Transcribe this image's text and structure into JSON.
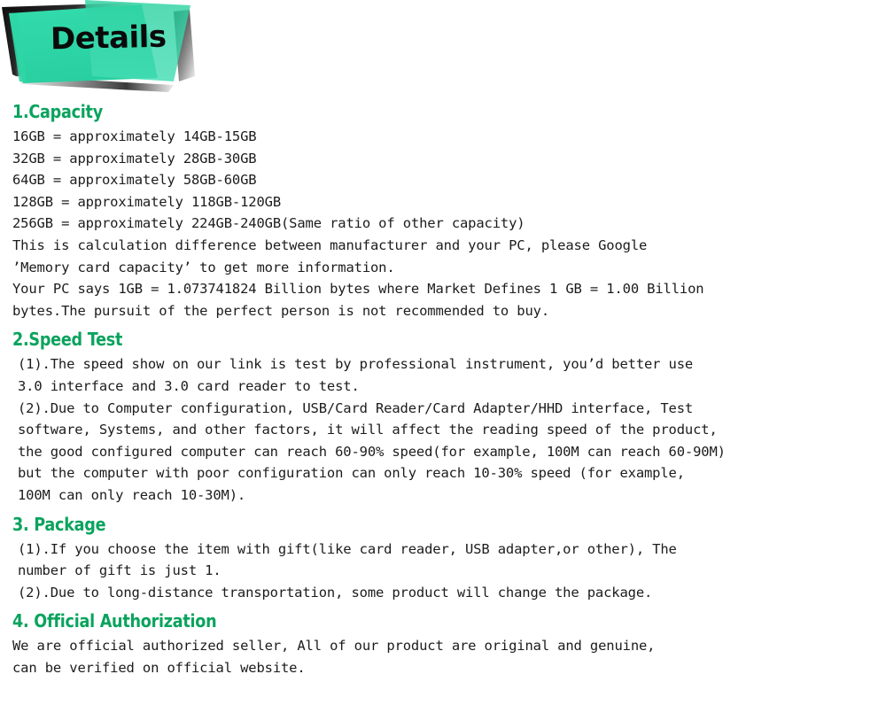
{
  "banner": {
    "title": "Details",
    "colors": {
      "green": "#2fd6a6",
      "green_light": "#4fe0bb",
      "shadow_dark": "#1a1a1a",
      "shadow_light": "#cfcfcf"
    }
  },
  "theme": {
    "heading_green": "#0aa35e",
    "body_text": "#1c1c1c",
    "background": "#ffffff"
  },
  "sections": [
    {
      "id": "capacity",
      "heading": "1.Capacity",
      "paragraphs": [
        "16GB = approximately 14GB-15GB\n32GB = approximately 28GB-30GB\n64GB = approximately 58GB-60GB\n128GB = approximately 118GB-120GB\n256GB = approximately 224GB-240GB(Same ratio of other capacity)\nThis is calculation difference between manufacturer and your PC, please Google\n’Memory card capacity’ to get more information.\nYour PC says 1GB = 1.073741824 Billion bytes where Market Defines 1 GB = 1.00 Billion\nbytes.The pursuit of the perfect person is not recommended to buy."
      ]
    },
    {
      "id": "speed-test",
      "heading": "2.Speed Test",
      "paragraphs": [
        "(1).The speed show on our link is test by professional instrument, you’d better use\n3.0 interface and 3.0 card reader to test.\n(2).Due to Computer configuration, USB/Card Reader/Card Adapter/HHD interface, Test\nsoftware, Systems, and other factors, it will affect the reading speed of the product,\nthe good configured computer can reach 60-90% speed(for example, 100M can reach 60-90M)\nbut the computer with poor configuration can only reach 10-30% speed (for example,\n100M can only reach 10-30M)."
      ]
    },
    {
      "id": "package",
      "heading": "3. Package",
      "paragraphs": [
        "(1).If you choose the item with gift(like card reader, USB adapter,or other), The\nnumber of gift is just 1.\n(2).Due to long-distance transportation, some product will change the package."
      ]
    },
    {
      "id": "official-authorization",
      "heading": "4. Official Authorization",
      "paragraphs": [
        "We are official authorized seller, All of our product are original and genuine,\ncan be verified on official website."
      ]
    }
  ]
}
